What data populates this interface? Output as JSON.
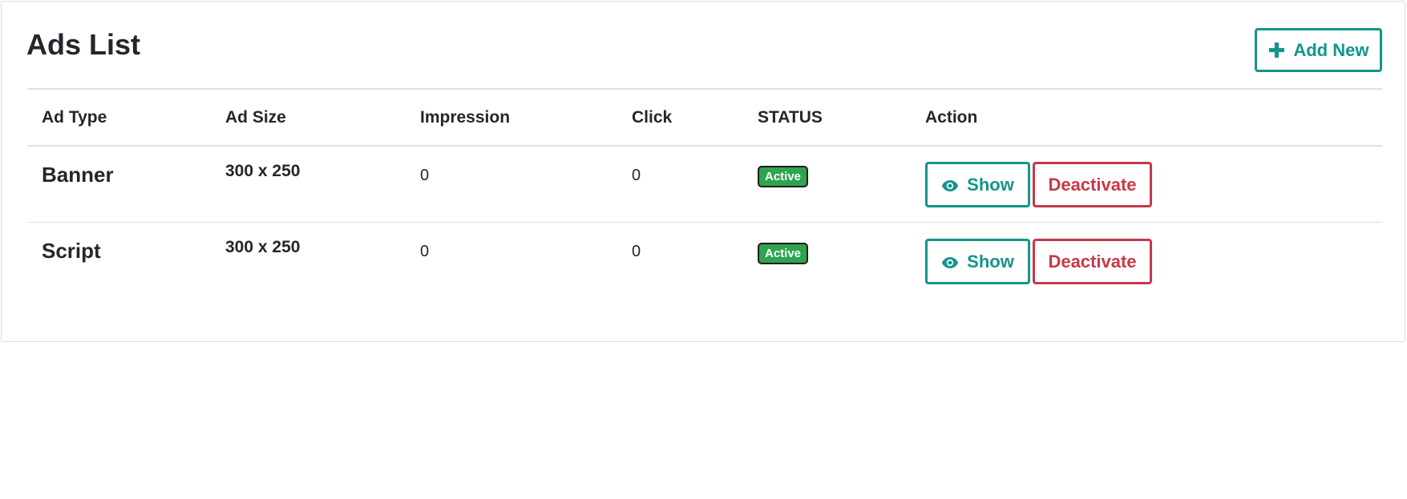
{
  "page": {
    "title": "Ads List",
    "add_button_label": "Add New",
    "add_button_icon": "plus-icon"
  },
  "table": {
    "columns": [
      "Ad Type",
      "Ad Size",
      "Impression",
      "Click",
      "STATUS",
      "Action"
    ],
    "rows": [
      {
        "ad_type": "Banner",
        "ad_size": "300 x 250",
        "impression": "0",
        "click": "0",
        "status": "Active",
        "show_label": "Show",
        "deactivate_label": "Deactivate"
      },
      {
        "ad_type": "Script",
        "ad_size": "300 x 250",
        "impression": "0",
        "click": "0",
        "status": "Active",
        "show_label": "Show",
        "deactivate_label": "Deactivate"
      }
    ]
  },
  "colors": {
    "primary_outline": "#12968a",
    "danger_outline": "#c7384b",
    "status_active": "#2ea44f"
  }
}
